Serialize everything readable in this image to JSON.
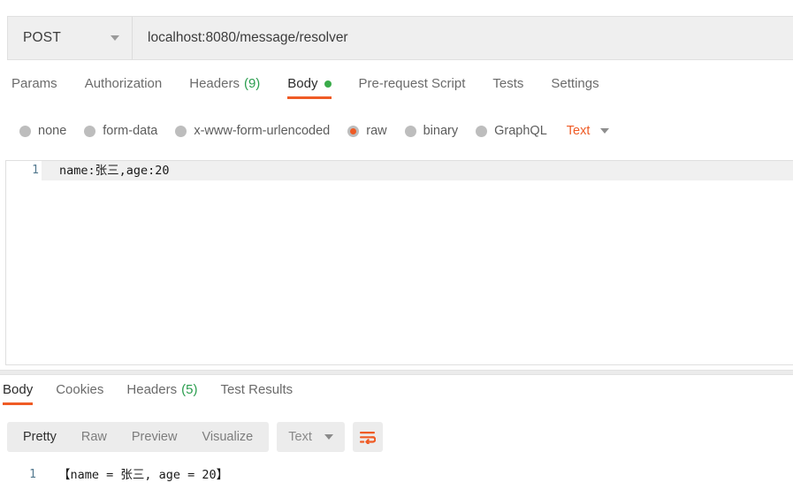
{
  "request": {
    "method": "POST",
    "method_caret_icon": "chevron-down-icon",
    "url": "localhost:8080/message/resolver",
    "tabs": [
      {
        "label": "Params",
        "count": "",
        "active": false,
        "dot": false
      },
      {
        "label": "Authorization",
        "count": "",
        "active": false,
        "dot": false
      },
      {
        "label": "Headers",
        "count": "(9)",
        "active": false,
        "dot": false
      },
      {
        "label": "Body",
        "count": "",
        "active": true,
        "dot": true
      },
      {
        "label": "Pre-request Script",
        "count": "",
        "active": false,
        "dot": false
      },
      {
        "label": "Tests",
        "count": "",
        "active": false,
        "dot": false
      },
      {
        "label": "Settings",
        "count": "",
        "active": false,
        "dot": false
      }
    ],
    "body_types": [
      {
        "label": "none",
        "selected": false
      },
      {
        "label": "form-data",
        "selected": false
      },
      {
        "label": "x-www-form-urlencoded",
        "selected": false
      },
      {
        "label": "raw",
        "selected": true
      },
      {
        "label": "binary",
        "selected": false
      },
      {
        "label": "GraphQL",
        "selected": false
      }
    ],
    "raw_format": "Text",
    "raw_format_caret_icon": "chevron-down-icon",
    "editor": {
      "lines": [
        {
          "number": "1",
          "text": "name:张三,age:20"
        }
      ]
    }
  },
  "response": {
    "tabs": [
      {
        "label": "Body",
        "count": "",
        "active": true
      },
      {
        "label": "Cookies",
        "count": "",
        "active": false
      },
      {
        "label": "Headers",
        "count": "(5)",
        "active": false
      },
      {
        "label": "Test Results",
        "count": "",
        "active": false
      }
    ],
    "view_modes": [
      {
        "label": "Pretty",
        "active": true
      },
      {
        "label": "Raw",
        "active": false
      },
      {
        "label": "Preview",
        "active": false
      },
      {
        "label": "Visualize",
        "active": false
      }
    ],
    "format": "Text",
    "format_caret_icon": "chevron-down-icon",
    "wrap_icon": "word-wrap-icon",
    "body": {
      "lines": [
        {
          "number": "1",
          "text": "【name = 张三, age = 20】"
        }
      ]
    }
  },
  "colors": {
    "accent": "#ef5b25",
    "success": "#2a9d4e",
    "dot": "#3aab4a",
    "gutter": "#52788e"
  }
}
